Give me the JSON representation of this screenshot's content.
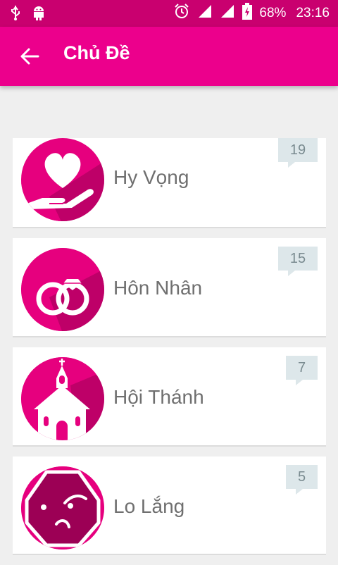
{
  "status_bar": {
    "battery": "68%",
    "time": "23:16",
    "icons": [
      "usb-icon",
      "android-icon",
      "alarm-icon",
      "signal-icon",
      "signal-icon",
      "battery-charging-icon"
    ]
  },
  "app_bar": {
    "title": "Chủ Đề",
    "back_icon": "arrow-left-icon"
  },
  "topics": [
    {
      "label": "Hy Vọng",
      "count": "19",
      "icon": "heart-in-hand-icon"
    },
    {
      "label": "Hôn Nhân",
      "count": "15",
      "icon": "wedding-rings-icon"
    },
    {
      "label": "Hội Thánh",
      "count": "7",
      "icon": "church-icon"
    },
    {
      "label": "Lo Lắng",
      "count": "5",
      "icon": "worried-face-icon"
    }
  ],
  "colors": {
    "status_bar": "#c9006f",
    "app_bar": "#ec008c",
    "avatar": "#e6007e",
    "badge_bg": "#dde7ea"
  }
}
